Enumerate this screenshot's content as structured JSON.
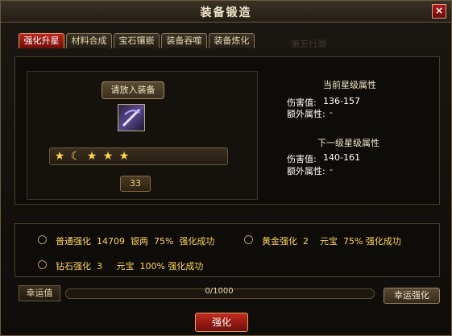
{
  "window": {
    "title": "装备锻造",
    "close_icon": "×"
  },
  "tabs": [
    {
      "label": "强化升星",
      "state": "active"
    },
    {
      "label": "材料合成",
      "state": "normal"
    },
    {
      "label": "宝石镶嵌",
      "state": "normal"
    },
    {
      "label": "装备吞噬",
      "state": "normal"
    },
    {
      "label": "装备炼化",
      "state": "normal"
    },
    {
      "label": "第五行湖",
      "state": "disabled"
    }
  ],
  "equip": {
    "slot_label": "请放入装备",
    "item_icon": "weapon-icon",
    "stars": [
      "★",
      "☾",
      "★",
      "★",
      "★"
    ],
    "count": "33"
  },
  "current": {
    "title": "当前星级属性",
    "damage_label": "伤害值:",
    "damage_value": "136-157",
    "extra_label": "额外属性:",
    "extra_value": "-"
  },
  "next": {
    "title": "下一级星级属性",
    "damage_label": "伤害值:",
    "damage_value": "140-161",
    "extra_label": "额外属性:",
    "extra_value": "-"
  },
  "options": [
    {
      "text": "普通强化  14709  银两  75%  强化成功"
    },
    {
      "text": "黄金强化  2    元宝  75% 强化成功"
    },
    {
      "text": "钻石强化  3     元宝  100% 强化成功"
    }
  ],
  "luck": {
    "label": "幸运值",
    "value_text": "0/1000",
    "fraction": 0,
    "button": "幸运强化"
  },
  "main_button": "强化",
  "colors": {
    "accent_red": "#b8261f",
    "option_gold": "#ffd25c"
  }
}
